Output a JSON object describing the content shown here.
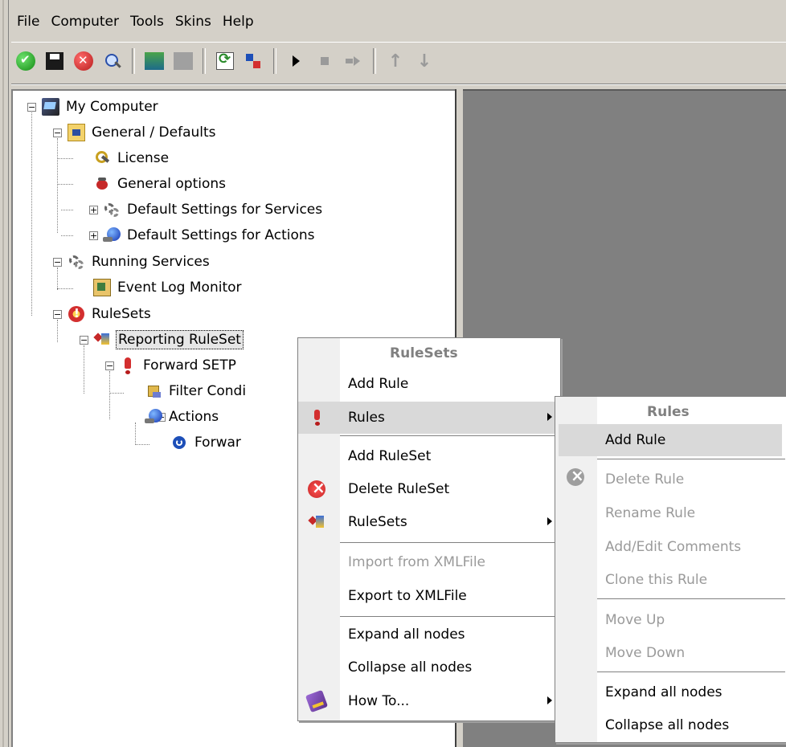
{
  "menubar": {
    "items": [
      "File",
      "Computer",
      "Tools",
      "Skins",
      "Help"
    ]
  },
  "toolbar": {
    "icons": [
      "ok-icon",
      "save-icon",
      "cancel-icon",
      "search-icon",
      "server-icon",
      "disabled-icon",
      "refresh-icon",
      "tree-icon",
      "play-icon",
      "stop-icon",
      "next-icon",
      "arrow-up-icon",
      "arrow-down-icon"
    ]
  },
  "tree": {
    "my_computer": "My Computer",
    "general_defaults": "General / Defaults",
    "license": "License",
    "general_options": "General options",
    "default_services": "Default Settings for Services",
    "default_actions": "Default Settings for Actions",
    "running_services": "Running Services",
    "event_log_monitor": "Event Log Monitor",
    "rulesets": "RuleSets",
    "reporting_ruleset": "Reporting RuleSet",
    "forward_setp": "Forward SETP",
    "filter_conditions": "Filter Condi",
    "actions": "Actions",
    "forward_action": "Forwar"
  },
  "ruleset_menu": {
    "title": "RuleSets",
    "add_rule": "Add Rule",
    "rules": "Rules",
    "add_ruleset": "Add RuleSet",
    "delete_ruleset": "Delete RuleSet",
    "rulesets": "RuleSets",
    "import_xml": "Import from XMLFile",
    "export_xml": "Export to XMLFile",
    "expand_all": "Expand all nodes",
    "collapse_all": "Collapse all nodes",
    "how_to": "How To..."
  },
  "rules_menu": {
    "title": "Rules",
    "add_rule": "Add Rule",
    "delete_rule": "Delete Rule",
    "rename_rule": "Rename Rule",
    "add_edit_comments": "Add/Edit Comments",
    "clone_rule": "Clone this Rule",
    "move_up": "Move Up",
    "move_down": "Move Down",
    "expand_all": "Expand all nodes",
    "collapse_all": "Collapse all nodes"
  }
}
